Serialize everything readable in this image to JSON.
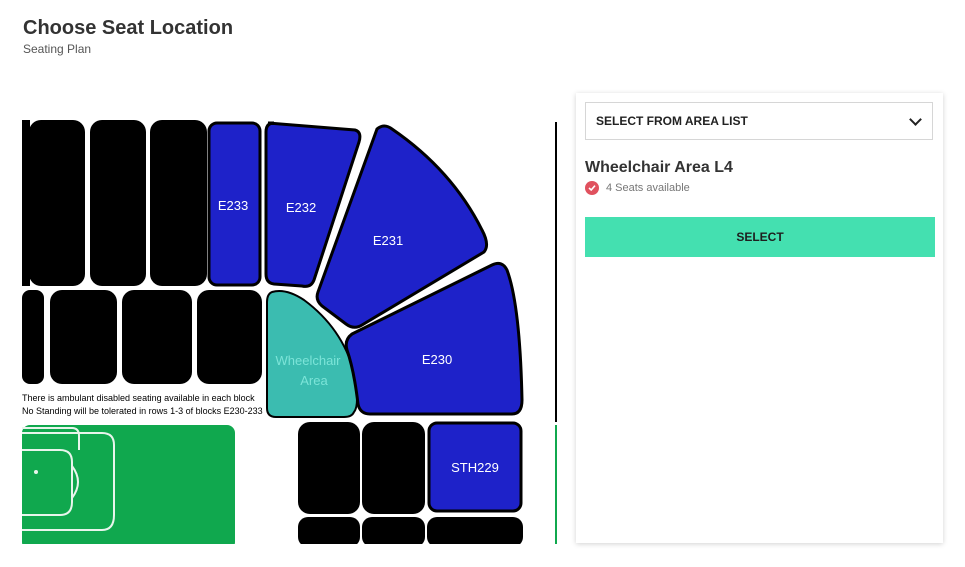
{
  "header": {
    "title": "Choose Seat Location",
    "subtitle": "Seating Plan"
  },
  "map": {
    "blocks": [
      "E233",
      "E232",
      "E231",
      "E230",
      "STH229"
    ],
    "wheelchair_area": [
      "Wheelchair",
      "Area"
    ],
    "notes": [
      "There is ambulant disabled seating available  in each block",
      "No Standing will be tolerated in rows 1-3 of blocks E230-233"
    ],
    "colors": {
      "available_block": "#1e22c9",
      "selected_block": "#3bbcb0",
      "unavailable_block": "#000000",
      "pitch": "#10a84e"
    }
  },
  "panel": {
    "area_select_label": "SELECT FROM AREA LIST",
    "area_name": "Wheelchair Area L4",
    "availability": "4 Seats available",
    "select_button": "SELECT",
    "colors": {
      "accent": "#44e0b0",
      "check": "#e0515e"
    }
  }
}
